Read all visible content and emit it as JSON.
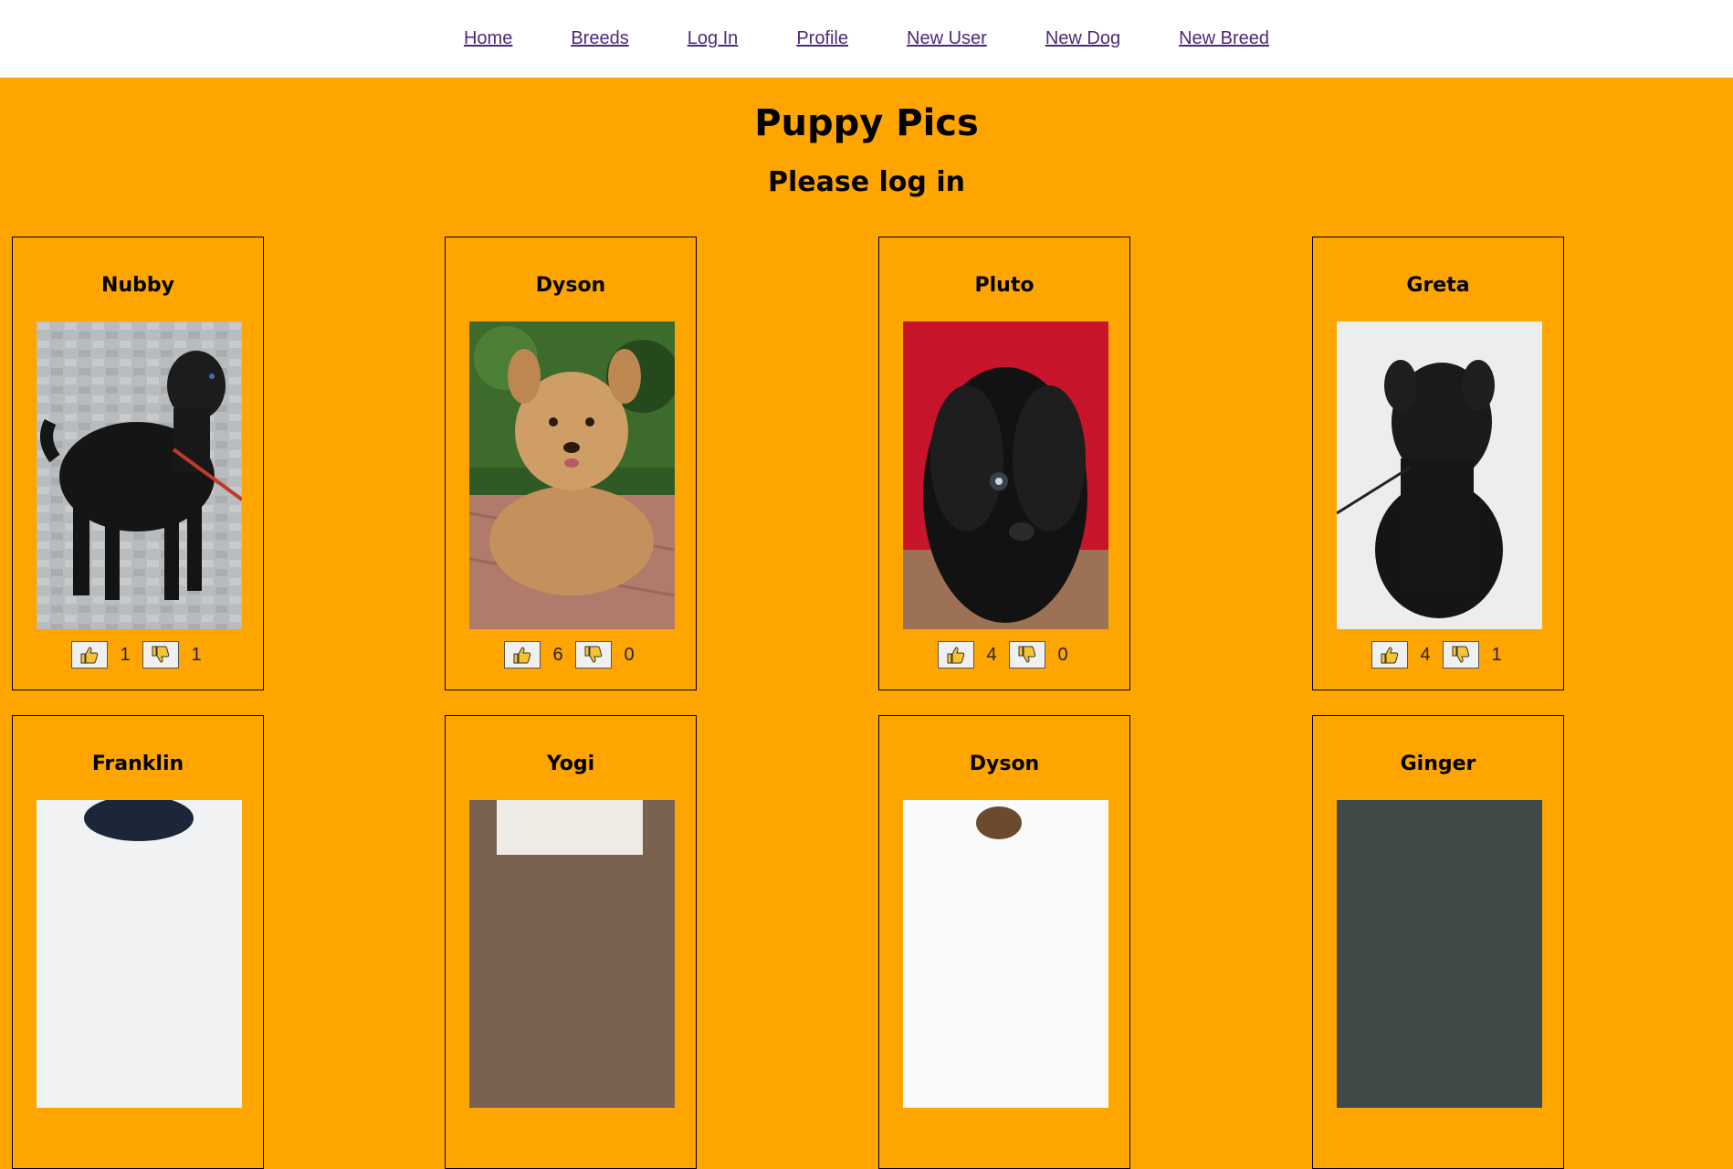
{
  "nav": [
    "Home",
    "Breeds",
    "Log In",
    "Profile",
    "New User",
    "New Dog",
    "New Breed"
  ],
  "title": "Puppy Pics",
  "subtitle": "Please log in",
  "dogs": [
    {
      "name": "Nubby",
      "up": "1",
      "down": "1"
    },
    {
      "name": "Dyson",
      "up": "6",
      "down": "0"
    },
    {
      "name": "Pluto",
      "up": "4",
      "down": "0"
    },
    {
      "name": "Greta",
      "up": "4",
      "down": "1"
    },
    {
      "name": "Franklin",
      "up": "",
      "down": ""
    },
    {
      "name": "Yogi",
      "up": "",
      "down": ""
    },
    {
      "name": "Dyson",
      "up": "",
      "down": ""
    },
    {
      "name": "Ginger",
      "up": "",
      "down": ""
    }
  ],
  "colors": {
    "background": "#ffa500",
    "link": "#4b2a7a"
  }
}
